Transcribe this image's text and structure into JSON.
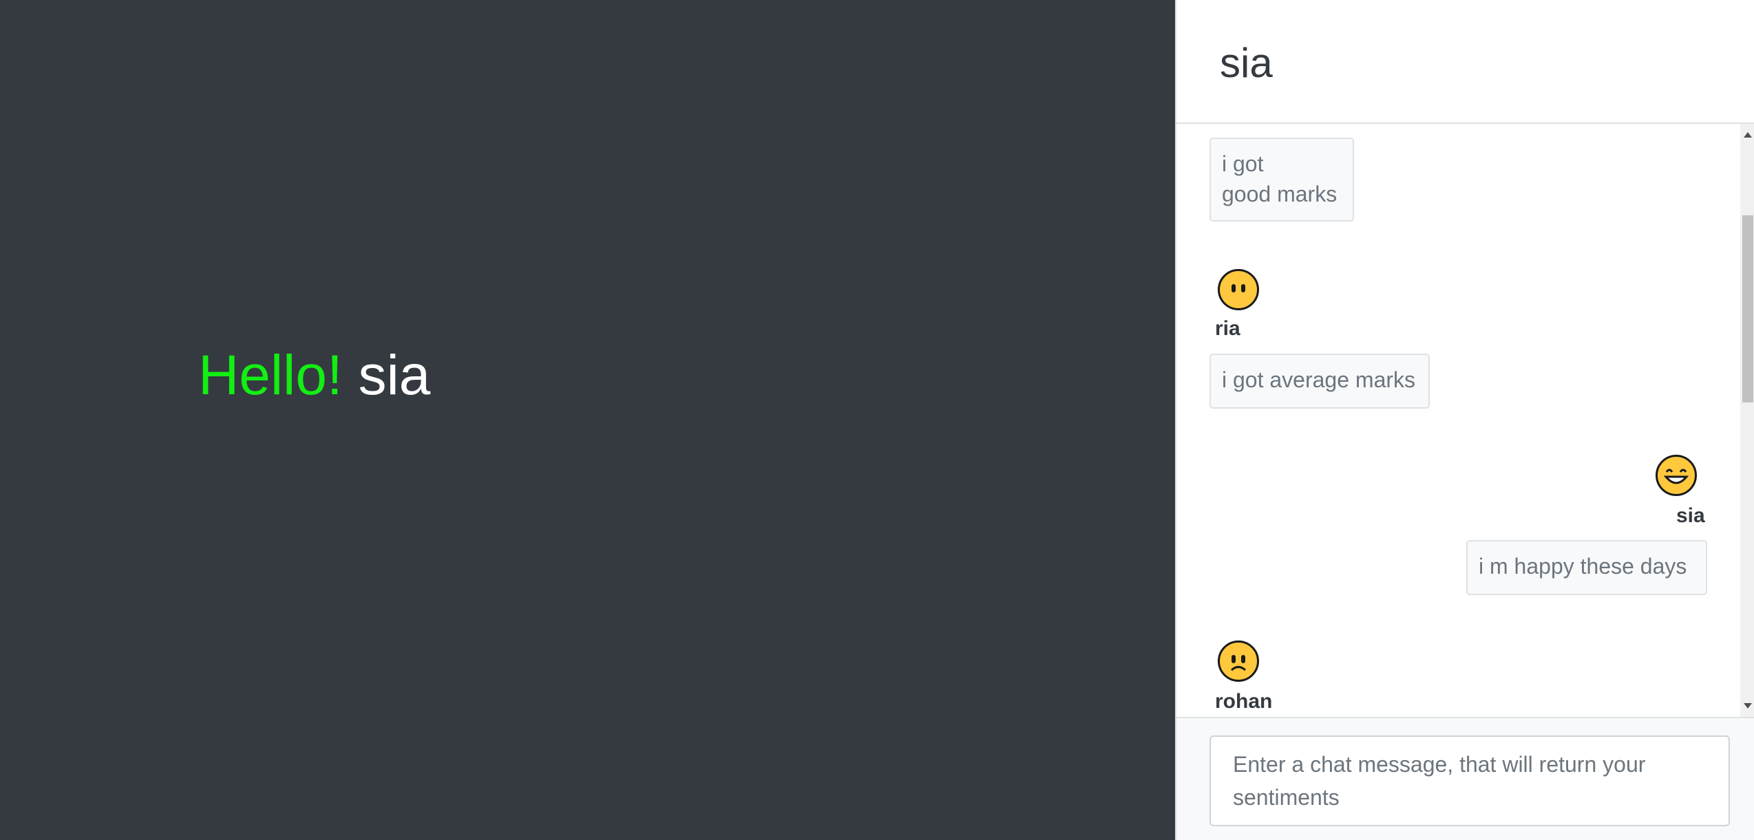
{
  "greeting": {
    "hello": "Hello!",
    "name": "sia"
  },
  "chat": {
    "title": "sia",
    "messages": [
      {
        "sender": "",
        "text": "i got\ngood marks",
        "align": "left",
        "emoji": null
      },
      {
        "sender": "ria",
        "text": "i got average marks",
        "align": "left",
        "emoji": "neutral-face-icon"
      },
      {
        "sender": "sia",
        "text": "i m happy these days",
        "align": "right",
        "emoji": "grinning-face-icon"
      },
      {
        "sender": "rohan",
        "text": "",
        "align": "left",
        "emoji": "frowning-face-icon"
      }
    ],
    "input_placeholder": "Enter a chat message, that will return your sentiments"
  },
  "colors": {
    "hello": "#13ee13",
    "left_background": "#343a40",
    "emoji_fill": "#ffc83d"
  }
}
